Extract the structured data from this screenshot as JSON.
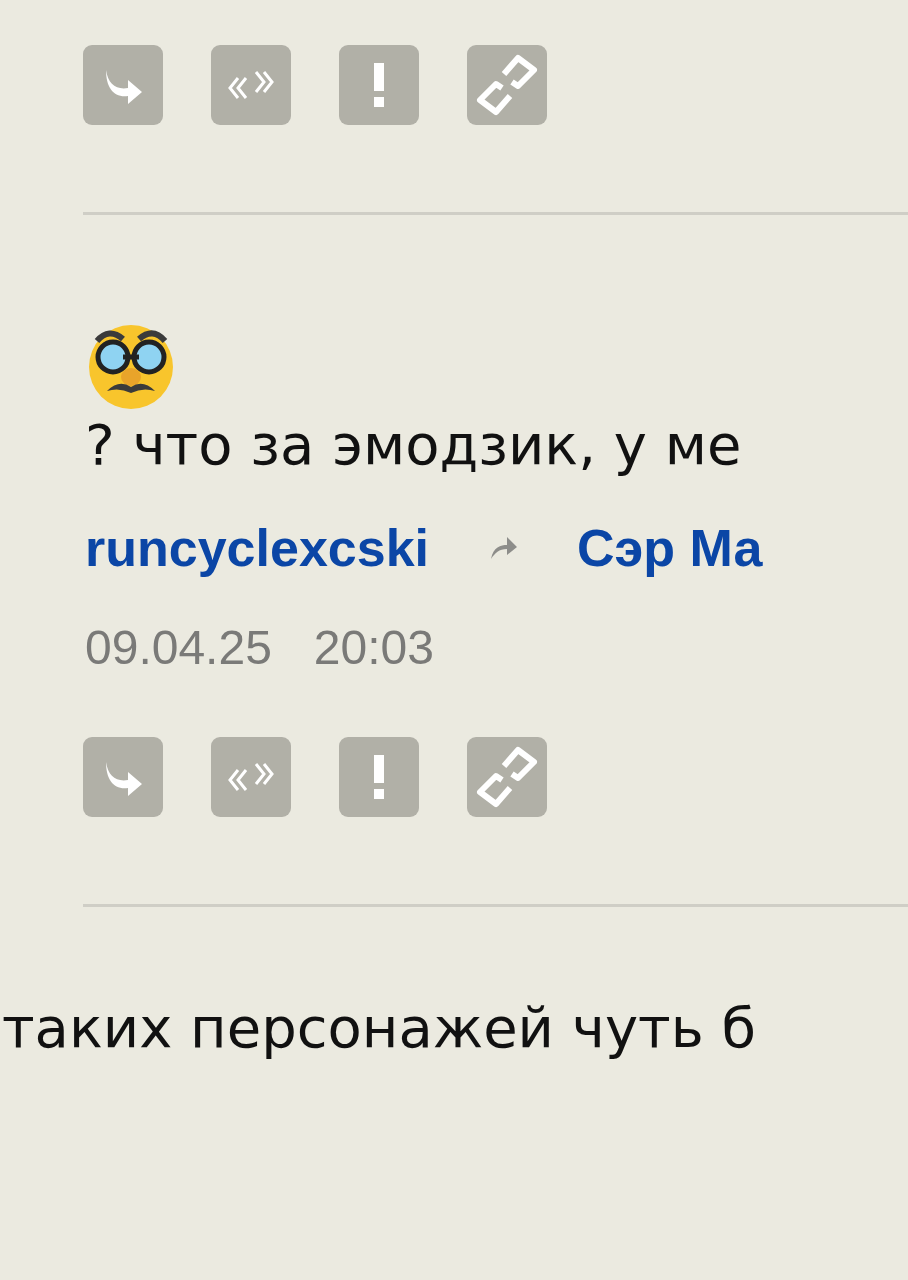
{
  "previous_post": {
    "actions": [
      {
        "kind": "reply"
      },
      {
        "kind": "quote"
      },
      {
        "kind": "report"
      },
      {
        "kind": "link"
      }
    ]
  },
  "post": {
    "emoji": {
      "kind": "disguise"
    },
    "text": "? что за эмодзик, у ме",
    "author": "runcyclexcski",
    "reply_to": "Сэр Ма",
    "date": "09.04.25",
    "time": "20:03",
    "actions": [
      {
        "kind": "reply"
      },
      {
        "kind": "quote"
      },
      {
        "kind": "report"
      },
      {
        "kind": "link"
      }
    ]
  },
  "next_post": {
    "text": "таких персонажей чуть б"
  }
}
